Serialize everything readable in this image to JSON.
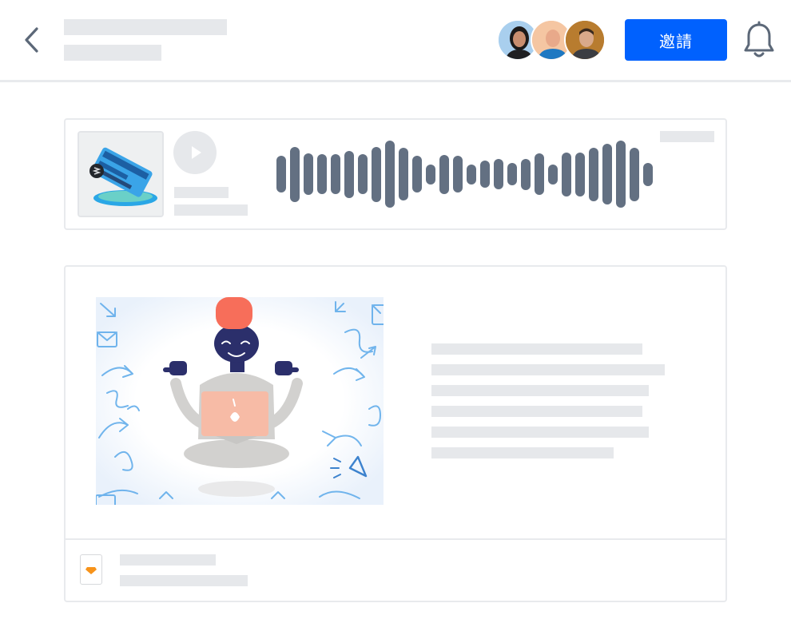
{
  "header": {
    "invite_label": "邀請"
  },
  "icons": {
    "back": "chevron-left",
    "notifications": "bell",
    "play": "play",
    "file": "sketch-diamond"
  },
  "colors": {
    "accent": "#0061fe",
    "waveform": "#637082",
    "skeleton": "#e6e8eb",
    "border": "#e8eaed",
    "illustration_head": "#2b2f6b",
    "illustration_hat": "#f76e5a",
    "illustration_laptop": "#f9b9a3",
    "illustration_lines": "#4da3e8",
    "file_badge": "#f7931a"
  },
  "audio_card": {
    "waveform_levels": [
      0.55,
      0.82,
      0.62,
      0.6,
      0.6,
      0.7,
      0.6,
      0.82,
      1.0,
      0.78,
      0.55,
      0.3,
      0.58,
      0.55,
      0.3,
      0.4,
      0.45,
      0.33,
      0.46,
      0.62,
      0.3,
      0.65,
      0.65,
      0.8,
      0.9,
      1.0,
      0.8,
      0.35
    ]
  }
}
